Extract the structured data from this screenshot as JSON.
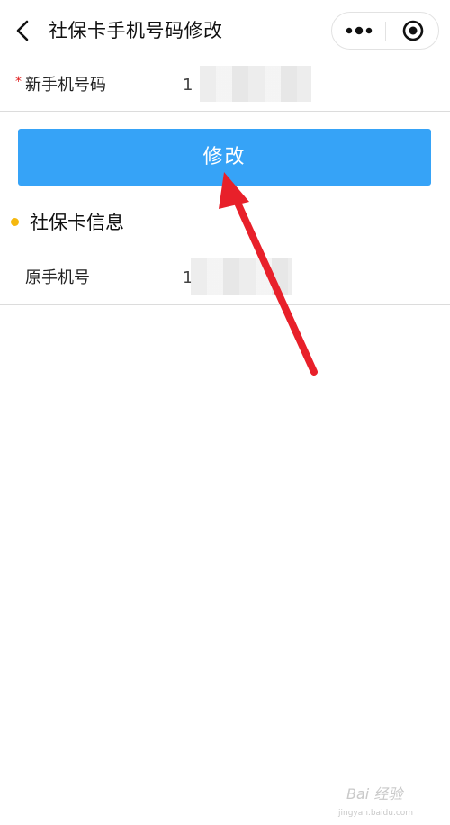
{
  "header": {
    "title": "社保卡手机号码修改",
    "back_icon": "chevron-left-icon",
    "more_icon": "more-dots-icon",
    "close_icon": "target-circle-icon"
  },
  "form": {
    "new_phone_label": "新手机号码",
    "required_mark": "*",
    "new_phone_value": "1",
    "submit_label": "修改"
  },
  "section": {
    "title": "社保卡信息",
    "dot_color": "#f5b80f",
    "old_phone_label": "原手机号",
    "old_phone_value": "1"
  },
  "colors": {
    "accent": "#36a3f7",
    "required": "#e02020",
    "annotation_arrow": "#e8202a"
  },
  "watermark": {
    "text": "Bai 经验",
    "url": "jingyan.baidu.com"
  }
}
